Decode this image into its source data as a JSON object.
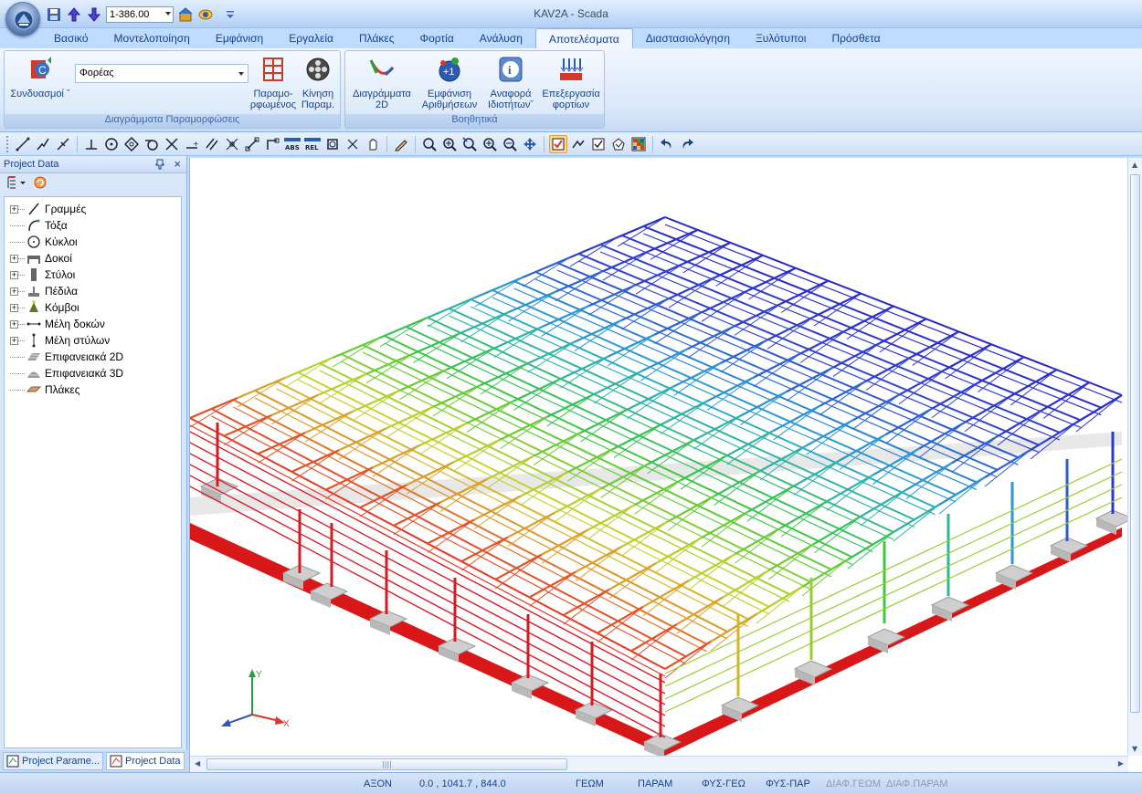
{
  "window": {
    "title": "KAV2A - Scada"
  },
  "qat": {
    "combo_value": "1-386.00"
  },
  "ribbon": {
    "tabs": [
      {
        "label": "Βασικό",
        "active": false
      },
      {
        "label": "Μοντελοποίηση",
        "active": false
      },
      {
        "label": "Εμφάνιση",
        "active": false
      },
      {
        "label": "Εργαλεία",
        "active": false
      },
      {
        "label": "Πλάκες",
        "active": false
      },
      {
        "label": "Φορτία",
        "active": false
      },
      {
        "label": "Ανάλυση",
        "active": false
      },
      {
        "label": "Αποτελέσματα",
        "active": true
      },
      {
        "label": "Διαστασιολόγηση",
        "active": false
      },
      {
        "label": "Ξυλότυποι",
        "active": false
      },
      {
        "label": "Πρόσθετα",
        "active": false
      }
    ],
    "group1": {
      "label": "Διαγράμματα Παραμορφώσεις",
      "combinations_label": "Συνδυασμοί",
      "combo_value": "Φορέας",
      "deformed_label_1": "Παραμο-",
      "deformed_label_2": "ρφωμένος",
      "motion_label_1": "Κίνηση",
      "motion_label_2": "Παραμ."
    },
    "group2": {
      "label": "Βοηθητικά",
      "diagrams_label_1": "Διαγράμματα",
      "diagrams_label_2": "2D",
      "numbering_label_1": "Εμφάνιση",
      "numbering_label_2": "Αριθμήσεων",
      "report_label_1": "Αναφορά",
      "report_label_2": "Ιδιοτήτων",
      "loads_label_1": "Επεξεργασία",
      "loads_label_2": "φορτίων"
    }
  },
  "panel": {
    "title": "Project Data",
    "tree": [
      {
        "label": "Γραμμές",
        "expandable": true,
        "icon": "line-icon"
      },
      {
        "label": "Τόξα",
        "expandable": false,
        "icon": "arc-icon"
      },
      {
        "label": "Κύκλοι",
        "expandable": false,
        "icon": "circle-icon"
      },
      {
        "label": "Δοκοί",
        "expandable": true,
        "icon": "beam-icon"
      },
      {
        "label": "Στύλοι",
        "expandable": true,
        "icon": "column-icon"
      },
      {
        "label": "Πέδιλα",
        "expandable": true,
        "icon": "footing-icon"
      },
      {
        "label": "Κόμβοι",
        "expandable": true,
        "icon": "node-icon"
      },
      {
        "label": "Μέλη δοκών",
        "expandable": true,
        "icon": "beam-member-icon"
      },
      {
        "label": "Μέλη στύλων",
        "expandable": true,
        "icon": "column-member-icon"
      },
      {
        "label": "Επιφανειακά 2D",
        "expandable": false,
        "icon": "surface-2d-icon"
      },
      {
        "label": "Επιφανειακά 3D",
        "expandable": false,
        "icon": "surface-3d-icon"
      },
      {
        "label": "Πλάκες",
        "expandable": false,
        "icon": "slab-icon"
      }
    ],
    "tabs": [
      {
        "label": "Project Parame...",
        "active": false
      },
      {
        "label": "Project Data",
        "active": true
      }
    ]
  },
  "viewport": {
    "axis_x": "X",
    "axis_y": "Y"
  },
  "status": {
    "axis": "ΑΞΟΝ",
    "coords": "0.0 , 1041.7 , 844.0",
    "geom": "ΓΕΩΜ",
    "param": "ΠΑΡΑΜ",
    "fys_geo": "ΦΥΣ-ΓΕΩ",
    "fys_par": "ΦΥΣ-ΠΑΡ",
    "diaf_geom": "ΔΙΑΦ.ΓΕΩΜ",
    "diaf_param": "ΔΙΑΦ.ΠΑΡΑΜ"
  },
  "colors": {
    "accent": "#15428b",
    "ribbon_bg": "#bfdbff",
    "active_tool": "#ffd98c"
  }
}
